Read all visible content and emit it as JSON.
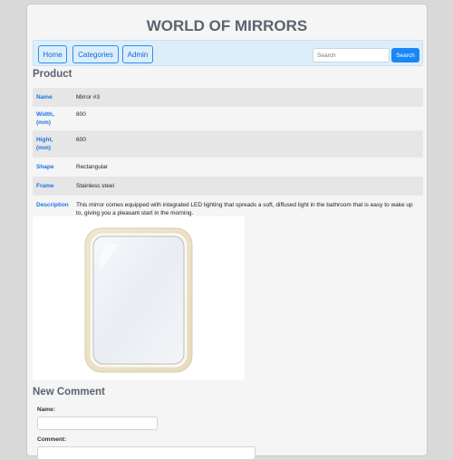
{
  "site": {
    "title": "WORLD OF MIRRORS"
  },
  "nav": {
    "items": [
      {
        "label": "Home"
      },
      {
        "label": "Categories"
      },
      {
        "label": "Admin"
      }
    ],
    "search": {
      "placeholder": "Search",
      "button_label": "Search"
    }
  },
  "product": {
    "heading": "Product",
    "rows": [
      {
        "label": "Name",
        "value": "Mirror #3"
      },
      {
        "label": "Width, (mm)",
        "value": "800"
      },
      {
        "label": "Hight, (mm)",
        "value": "600"
      },
      {
        "label": "Shape",
        "value": "Rectangular"
      },
      {
        "label": "Frame",
        "value": "Stainless steel"
      },
      {
        "label": "Description",
        "value": "This mirror comes equipped with integrated LED lighting that spreads a soft, diffused light in the bathroom that is easy to wake up to, giving you a pleasant start in the morning."
      }
    ]
  },
  "comment_form": {
    "heading": "New Comment",
    "name_label": "Name:",
    "comment_label": "Comment:"
  }
}
